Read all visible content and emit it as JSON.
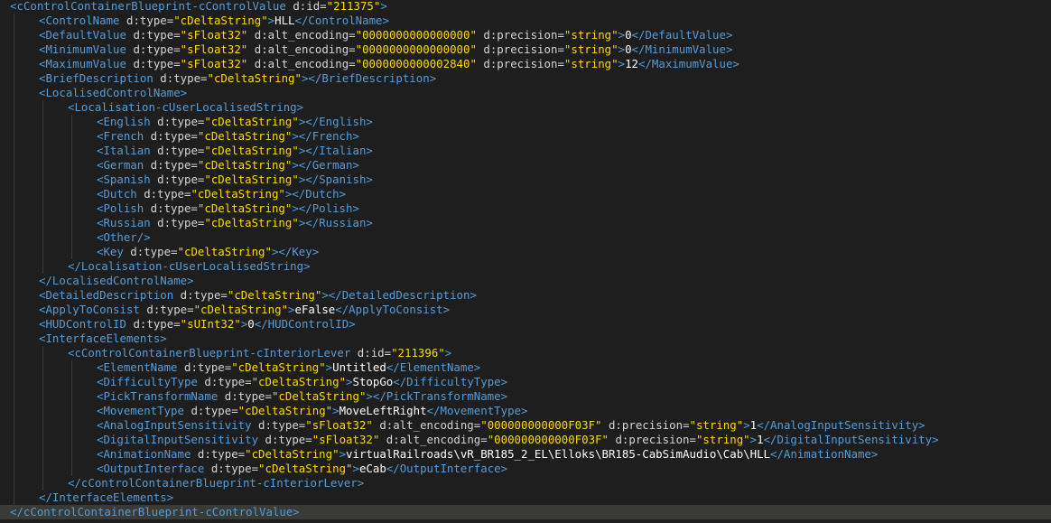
{
  "editor": {
    "current_line": 35,
    "lines": [
      {
        "indent": 0,
        "tokens": [
          {
            "t": "t",
            "s": "<cControlContainerBlueprint-cControlValue"
          },
          {
            "t": "a",
            "s": " d:id="
          },
          {
            "t": "v",
            "s": "\"211375\""
          },
          {
            "t": "t",
            "s": ">"
          }
        ]
      },
      {
        "indent": 1,
        "tokens": [
          {
            "t": "t",
            "s": "<ControlName"
          },
          {
            "t": "a",
            "s": " d:type="
          },
          {
            "t": "v",
            "s": "\"cDeltaString\""
          },
          {
            "t": "t",
            "s": ">"
          },
          {
            "t": "x",
            "s": "HLL"
          },
          {
            "t": "t",
            "s": "</ControlName>"
          }
        ]
      },
      {
        "indent": 1,
        "tokens": [
          {
            "t": "t",
            "s": "<DefaultValue"
          },
          {
            "t": "a",
            "s": " d:type="
          },
          {
            "t": "v",
            "s": "\"sFloat32\""
          },
          {
            "t": "a",
            "s": " d:alt_encoding="
          },
          {
            "t": "v",
            "s": "\"0000000000000000\""
          },
          {
            "t": "a",
            "s": " d:precision="
          },
          {
            "t": "v",
            "s": "\"string\""
          },
          {
            "t": "t",
            "s": ">"
          },
          {
            "t": "x",
            "s": "0"
          },
          {
            "t": "t",
            "s": "</DefaultValue>"
          }
        ]
      },
      {
        "indent": 1,
        "tokens": [
          {
            "t": "t",
            "s": "<MinimumValue"
          },
          {
            "t": "a",
            "s": " d:type="
          },
          {
            "t": "v",
            "s": "\"sFloat32\""
          },
          {
            "t": "a",
            "s": " d:alt_encoding="
          },
          {
            "t": "v",
            "s": "\"0000000000000000\""
          },
          {
            "t": "a",
            "s": " d:precision="
          },
          {
            "t": "v",
            "s": "\"string\""
          },
          {
            "t": "t",
            "s": ">"
          },
          {
            "t": "x",
            "s": "0"
          },
          {
            "t": "t",
            "s": "</MinimumValue>"
          }
        ]
      },
      {
        "indent": 1,
        "tokens": [
          {
            "t": "t",
            "s": "<MaximumValue"
          },
          {
            "t": "a",
            "s": " d:type="
          },
          {
            "t": "v",
            "s": "\"sFloat32\""
          },
          {
            "t": "a",
            "s": " d:alt_encoding="
          },
          {
            "t": "v",
            "s": "\"0000000000002840\""
          },
          {
            "t": "a",
            "s": " d:precision="
          },
          {
            "t": "v",
            "s": "\"string\""
          },
          {
            "t": "t",
            "s": ">"
          },
          {
            "t": "x",
            "s": "12"
          },
          {
            "t": "t",
            "s": "</MaximumValue>"
          }
        ]
      },
      {
        "indent": 1,
        "tokens": [
          {
            "t": "t",
            "s": "<BriefDescription"
          },
          {
            "t": "a",
            "s": " d:type="
          },
          {
            "t": "v",
            "s": "\"cDeltaString\""
          },
          {
            "t": "t",
            "s": "></BriefDescription>"
          }
        ]
      },
      {
        "indent": 1,
        "tokens": [
          {
            "t": "t",
            "s": "<LocalisedControlName>"
          }
        ]
      },
      {
        "indent": 2,
        "tokens": [
          {
            "t": "t",
            "s": "<Localisation-cUserLocalisedString>"
          }
        ]
      },
      {
        "indent": 3,
        "tokens": [
          {
            "t": "t",
            "s": "<English"
          },
          {
            "t": "a",
            "s": " d:type="
          },
          {
            "t": "v",
            "s": "\"cDeltaString\""
          },
          {
            "t": "t",
            "s": "></English>"
          }
        ]
      },
      {
        "indent": 3,
        "tokens": [
          {
            "t": "t",
            "s": "<French"
          },
          {
            "t": "a",
            "s": " d:type="
          },
          {
            "t": "v",
            "s": "\"cDeltaString\""
          },
          {
            "t": "t",
            "s": "></French>"
          }
        ]
      },
      {
        "indent": 3,
        "tokens": [
          {
            "t": "t",
            "s": "<Italian"
          },
          {
            "t": "a",
            "s": " d:type="
          },
          {
            "t": "v",
            "s": "\"cDeltaString\""
          },
          {
            "t": "t",
            "s": "></Italian>"
          }
        ]
      },
      {
        "indent": 3,
        "tokens": [
          {
            "t": "t",
            "s": "<German"
          },
          {
            "t": "a",
            "s": " d:type="
          },
          {
            "t": "v",
            "s": "\"cDeltaString\""
          },
          {
            "t": "t",
            "s": "></German>"
          }
        ]
      },
      {
        "indent": 3,
        "tokens": [
          {
            "t": "t",
            "s": "<Spanish"
          },
          {
            "t": "a",
            "s": " d:type="
          },
          {
            "t": "v",
            "s": "\"cDeltaString\""
          },
          {
            "t": "t",
            "s": "></Spanish>"
          }
        ]
      },
      {
        "indent": 3,
        "tokens": [
          {
            "t": "t",
            "s": "<Dutch"
          },
          {
            "t": "a",
            "s": " d:type="
          },
          {
            "t": "v",
            "s": "\"cDeltaString\""
          },
          {
            "t": "t",
            "s": "></Dutch>"
          }
        ]
      },
      {
        "indent": 3,
        "tokens": [
          {
            "t": "t",
            "s": "<Polish"
          },
          {
            "t": "a",
            "s": " d:type="
          },
          {
            "t": "v",
            "s": "\"cDeltaString\""
          },
          {
            "t": "t",
            "s": "></Polish>"
          }
        ]
      },
      {
        "indent": 3,
        "tokens": [
          {
            "t": "t",
            "s": "<Russian"
          },
          {
            "t": "a",
            "s": " d:type="
          },
          {
            "t": "v",
            "s": "\"cDeltaString\""
          },
          {
            "t": "t",
            "s": "></Russian>"
          }
        ]
      },
      {
        "indent": 3,
        "tokens": [
          {
            "t": "t",
            "s": "<Other/>"
          }
        ]
      },
      {
        "indent": 3,
        "tokens": [
          {
            "t": "t",
            "s": "<Key"
          },
          {
            "t": "a",
            "s": " d:type="
          },
          {
            "t": "v",
            "s": "\"cDeltaString\""
          },
          {
            "t": "t",
            "s": "></Key>"
          }
        ]
      },
      {
        "indent": 2,
        "tokens": [
          {
            "t": "t",
            "s": "</Localisation-cUserLocalisedString>"
          }
        ]
      },
      {
        "indent": 1,
        "tokens": [
          {
            "t": "t",
            "s": "</LocalisedControlName>"
          }
        ]
      },
      {
        "indent": 1,
        "tokens": [
          {
            "t": "t",
            "s": "<DetailedDescription"
          },
          {
            "t": "a",
            "s": " d:type="
          },
          {
            "t": "v",
            "s": "\"cDeltaString\""
          },
          {
            "t": "t",
            "s": "></DetailedDescription>"
          }
        ]
      },
      {
        "indent": 1,
        "tokens": [
          {
            "t": "t",
            "s": "<ApplyToConsist"
          },
          {
            "t": "a",
            "s": " d:type="
          },
          {
            "t": "v",
            "s": "\"cDeltaString\""
          },
          {
            "t": "t",
            "s": ">"
          },
          {
            "t": "x",
            "s": "eFalse"
          },
          {
            "t": "t",
            "s": "</ApplyToConsist>"
          }
        ]
      },
      {
        "indent": 1,
        "tokens": [
          {
            "t": "t",
            "s": "<HUDControlID"
          },
          {
            "t": "a",
            "s": " d:type="
          },
          {
            "t": "v",
            "s": "\"sUInt32\""
          },
          {
            "t": "t",
            "s": ">"
          },
          {
            "t": "x",
            "s": "0"
          },
          {
            "t": "t",
            "s": "</HUDControlID>"
          }
        ]
      },
      {
        "indent": 1,
        "tokens": [
          {
            "t": "t",
            "s": "<InterfaceElements>"
          }
        ]
      },
      {
        "indent": 2,
        "tokens": [
          {
            "t": "t",
            "s": "<cControlContainerBlueprint-cInteriorLever"
          },
          {
            "t": "a",
            "s": " d:id="
          },
          {
            "t": "v",
            "s": "\"211396\""
          },
          {
            "t": "t",
            "s": ">"
          }
        ]
      },
      {
        "indent": 3,
        "tokens": [
          {
            "t": "t",
            "s": "<ElementName"
          },
          {
            "t": "a",
            "s": " d:type="
          },
          {
            "t": "v",
            "s": "\"cDeltaString\""
          },
          {
            "t": "t",
            "s": ">"
          },
          {
            "t": "x",
            "s": "Untitled"
          },
          {
            "t": "t",
            "s": "</ElementName>"
          }
        ]
      },
      {
        "indent": 3,
        "tokens": [
          {
            "t": "t",
            "s": "<DifficultyType"
          },
          {
            "t": "a",
            "s": " d:type="
          },
          {
            "t": "v",
            "s": "\"cDeltaString\""
          },
          {
            "t": "t",
            "s": ">"
          },
          {
            "t": "x",
            "s": "StopGo"
          },
          {
            "t": "t",
            "s": "</DifficultyType>"
          }
        ]
      },
      {
        "indent": 3,
        "tokens": [
          {
            "t": "t",
            "s": "<PickTransformName"
          },
          {
            "t": "a",
            "s": " d:type="
          },
          {
            "t": "v",
            "s": "\"cDeltaString\""
          },
          {
            "t": "t",
            "s": "></PickTransformName>"
          }
        ]
      },
      {
        "indent": 3,
        "tokens": [
          {
            "t": "t",
            "s": "<MovementType"
          },
          {
            "t": "a",
            "s": " d:type="
          },
          {
            "t": "v",
            "s": "\"cDeltaString\""
          },
          {
            "t": "t",
            "s": ">"
          },
          {
            "t": "x",
            "s": "MoveLeftRight"
          },
          {
            "t": "t",
            "s": "</MovementType>"
          }
        ]
      },
      {
        "indent": 3,
        "tokens": [
          {
            "t": "t",
            "s": "<AnalogInputSensitivity"
          },
          {
            "t": "a",
            "s": " d:type="
          },
          {
            "t": "v",
            "s": "\"sFloat32\""
          },
          {
            "t": "a",
            "s": " d:alt_encoding="
          },
          {
            "t": "v",
            "s": "\"000000000000F03F\""
          },
          {
            "t": "a",
            "s": " d:precision="
          },
          {
            "t": "v",
            "s": "\"string\""
          },
          {
            "t": "t",
            "s": ">"
          },
          {
            "t": "x",
            "s": "1"
          },
          {
            "t": "t",
            "s": "</AnalogInputSensitivity>"
          }
        ]
      },
      {
        "indent": 3,
        "tokens": [
          {
            "t": "t",
            "s": "<DigitalInputSensitivity"
          },
          {
            "t": "a",
            "s": " d:type="
          },
          {
            "t": "v",
            "s": "\"sFloat32\""
          },
          {
            "t": "a",
            "s": " d:alt_encoding="
          },
          {
            "t": "v",
            "s": "\"000000000000F03F\""
          },
          {
            "t": "a",
            "s": " d:precision="
          },
          {
            "t": "v",
            "s": "\"string\""
          },
          {
            "t": "t",
            "s": ">"
          },
          {
            "t": "x",
            "s": "1"
          },
          {
            "t": "t",
            "s": "</DigitalInputSensitivity>"
          }
        ]
      },
      {
        "indent": 3,
        "tokens": [
          {
            "t": "t",
            "s": "<AnimationName"
          },
          {
            "t": "a",
            "s": " d:type="
          },
          {
            "t": "v",
            "s": "\"cDeltaString\""
          },
          {
            "t": "t",
            "s": ">"
          },
          {
            "t": "x",
            "s": "virtualRailroads\\vR_BR185_2_EL\\Elloks\\BR185-CabSimAudio\\Cab\\HLL"
          },
          {
            "t": "t",
            "s": "</AnimationName>"
          }
        ]
      },
      {
        "indent": 3,
        "tokens": [
          {
            "t": "t",
            "s": "<OutputInterface"
          },
          {
            "t": "a",
            "s": " d:type="
          },
          {
            "t": "v",
            "s": "\"cDeltaString\""
          },
          {
            "t": "t",
            "s": ">"
          },
          {
            "t": "x",
            "s": "eCab"
          },
          {
            "t": "t",
            "s": "</OutputInterface>"
          }
        ]
      },
      {
        "indent": 2,
        "tokens": [
          {
            "t": "t",
            "s": "</cControlContainerBlueprint-cInteriorLever>"
          }
        ]
      },
      {
        "indent": 1,
        "tokens": [
          {
            "t": "t",
            "s": "</InterfaceElements>"
          }
        ]
      },
      {
        "indent": 0,
        "tokens": [
          {
            "t": "t",
            "s": "</cControlContainerBlueprint-cControlValue>"
          }
        ]
      }
    ]
  }
}
